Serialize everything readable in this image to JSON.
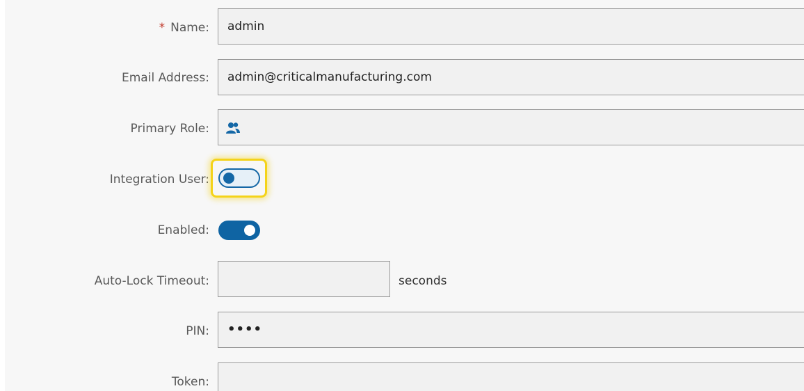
{
  "form": {
    "name": {
      "required_mark": "*",
      "label": "Name:",
      "value": "admin"
    },
    "email": {
      "label": "Email Address:",
      "value": "admin@criticalmanufacturing.com"
    },
    "primary_role": {
      "label": "Primary Role:",
      "icon": "users-icon",
      "value": ""
    },
    "integration_user": {
      "label": "Integration User:",
      "state": "off",
      "highlighted": true
    },
    "enabled": {
      "label": "Enabled:",
      "state": "on"
    },
    "auto_lock_timeout": {
      "label": "Auto-Lock Timeout:",
      "value": "",
      "unit": "seconds"
    },
    "pin": {
      "label": "PIN:",
      "value": "••••"
    },
    "token": {
      "label": "Token:",
      "value": ""
    }
  },
  "colors": {
    "accent": "#0f64a3",
    "highlight": "#f4d31a",
    "required": "#c0392b"
  }
}
